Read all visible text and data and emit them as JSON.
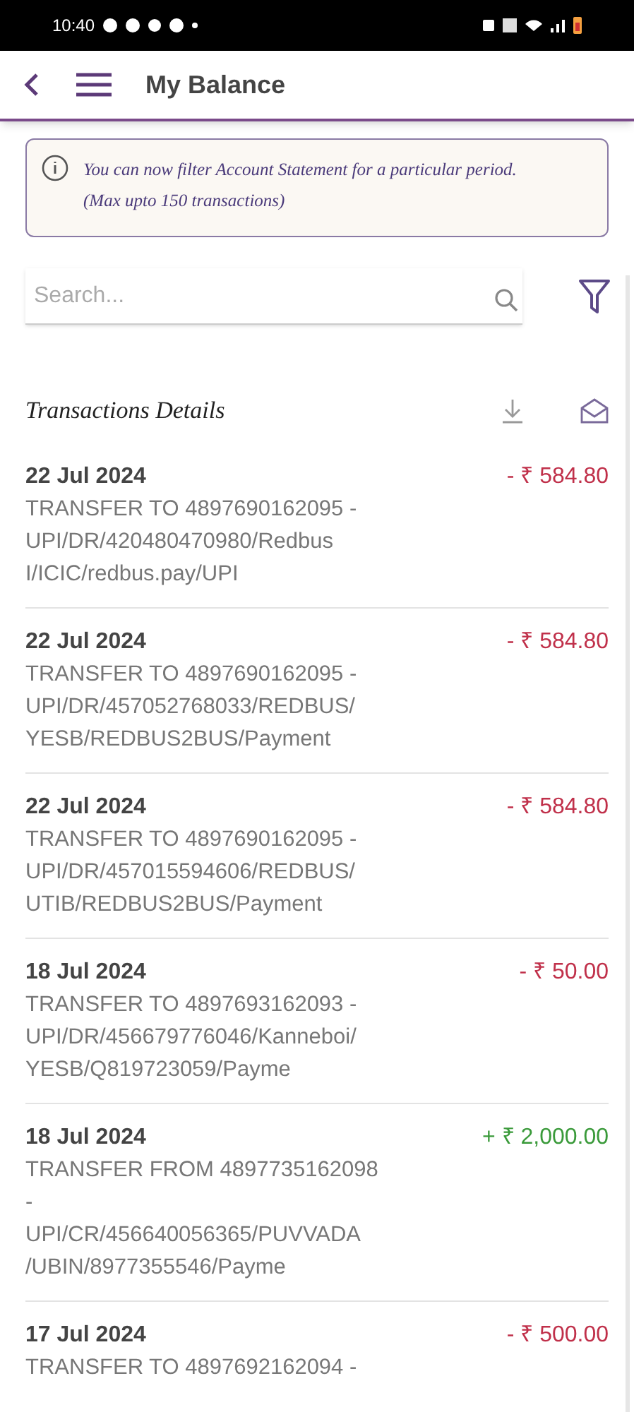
{
  "status_bar": {
    "time": "10:40"
  },
  "header": {
    "title": "My Balance"
  },
  "notice": {
    "lines": [
      "You can now filter Account Statement for a particular period.",
      "(Max upto 150 transactions)"
    ]
  },
  "search": {
    "placeholder": "Search..."
  },
  "section": {
    "title": "Transactions Details"
  },
  "transactions": [
    {
      "date": "22 Jul 2024",
      "amount": "- ₹ 584.80",
      "kind": "debit",
      "lines": [
        "TRANSFER TO 4897690162095 -",
        "UPI/DR/420480470980/Redbus",
        "I/ICIC/redbus.pay/UPI"
      ]
    },
    {
      "date": "22 Jul 2024",
      "amount": "- ₹ 584.80",
      "kind": "debit",
      "lines": [
        "TRANSFER TO 4897690162095 -",
        "UPI/DR/457052768033/REDBUS/",
        "YESB/REDBUS2BUS/Payment"
      ]
    },
    {
      "date": "22 Jul 2024",
      "amount": "- ₹ 584.80",
      "kind": "debit",
      "lines": [
        "TRANSFER TO 4897690162095 -",
        "UPI/DR/457015594606/REDBUS/",
        "UTIB/REDBUS2BUS/Payment"
      ]
    },
    {
      "date": "18 Jul 2024",
      "amount": "- ₹ 50.00",
      "kind": "debit",
      "lines": [
        "TRANSFER TO 4897693162093 -",
        "UPI/DR/456679776046/Kanneboi/",
        "YESB/Q819723059/Payme"
      ]
    },
    {
      "date": "18 Jul 2024",
      "amount": "+ ₹ 2,000.00",
      "kind": "credit",
      "lines": [
        "TRANSFER FROM 4897735162098",
        "-",
        "UPI/CR/456640056365/PUVVADA",
        "/UBIN/8977355546/Payme"
      ]
    },
    {
      "date": "17 Jul 2024",
      "amount": "- ₹ 500.00",
      "kind": "debit",
      "lines": [
        "TRANSFER TO 4897692162094 -"
      ]
    }
  ]
}
